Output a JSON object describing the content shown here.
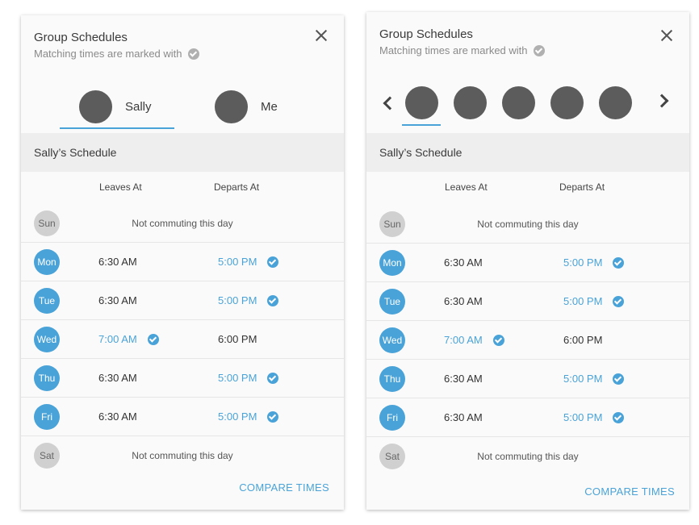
{
  "left": {
    "title": "Group Schedules",
    "subtitle": "Matching times are marked with",
    "people": [
      {
        "name": "Sally"
      },
      {
        "name": "Me"
      }
    ],
    "schedule_title": "Sally’s Schedule",
    "col_leaves": "Leaves At",
    "col_departs": "Departs At",
    "compare": "COMPARE TIMES"
  },
  "right": {
    "title": "Group Schedules",
    "subtitle": "Matching times are marked with",
    "avatar_count": 5,
    "schedule_title": "Sally’s Schedule",
    "col_leaves": "Leaves At",
    "col_departs": "Departs At",
    "compare": "COMPARE TIMES"
  },
  "days": [
    {
      "day": "Sun",
      "commuting": false,
      "note": "Not commuting this day"
    },
    {
      "day": "Mon",
      "commuting": true,
      "leaves": "6:30 AM",
      "departs": "5:00 PM",
      "match": "departs"
    },
    {
      "day": "Tue",
      "commuting": true,
      "leaves": "6:30 AM",
      "departs": "5:00 PM",
      "match": "departs"
    },
    {
      "day": "Wed",
      "commuting": true,
      "leaves": "7:00 AM",
      "departs": "6:00 PM",
      "match": "leaves"
    },
    {
      "day": "Thu",
      "commuting": true,
      "leaves": "6:30 AM",
      "departs": "5:00 PM",
      "match": "departs"
    },
    {
      "day": "Fri",
      "commuting": true,
      "leaves": "6:30 AM",
      "departs": "5:00 PM",
      "match": "departs"
    },
    {
      "day": "Sat",
      "commuting": false,
      "note": "Not commuting this day"
    }
  ],
  "colors": {
    "accent": "#4aa3d8",
    "avatar": "#5c5c5c",
    "day_off": "#d0d0d0"
  }
}
